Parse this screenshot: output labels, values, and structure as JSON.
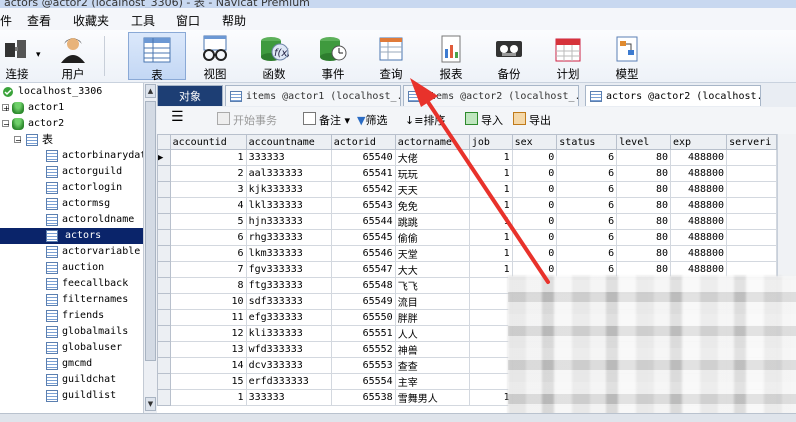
{
  "window": {
    "title": "actors @actor2 (localhost_3306) - 表 - Navicat Premium"
  },
  "menu": [
    "件",
    "查看",
    "收藏夹",
    "工具",
    "窗口",
    "帮助"
  ],
  "toolbar": {
    "items": [
      {
        "label": "连接",
        "icon": "plug-icon"
      },
      {
        "label": "用户",
        "icon": "user-icon"
      },
      {
        "label": "表",
        "icon": "table-icon"
      },
      {
        "label": "视图",
        "icon": "view-glasses-icon"
      },
      {
        "label": "函数",
        "icon": "function-icon"
      },
      {
        "label": "事件",
        "icon": "event-clock-icon"
      },
      {
        "label": "查询",
        "icon": "query-icon"
      },
      {
        "label": "报表",
        "icon": "report-icon"
      },
      {
        "label": "备份",
        "icon": "backup-icon"
      },
      {
        "label": "计划",
        "icon": "calendar-icon"
      },
      {
        "label": "模型",
        "icon": "model-icon"
      }
    ],
    "active": "表"
  },
  "tree": {
    "connection": "localhost_3306",
    "databases": [
      "actor1",
      "actor2"
    ],
    "group_label": "表",
    "tables": [
      "actorbinarydata",
      "actorguild",
      "actorlogin",
      "actormsg",
      "actoroldname",
      "actors",
      "actorvariable",
      "auction",
      "feecallback",
      "filternames",
      "friends",
      "globalmails",
      "globaluser",
      "gmcmd",
      "guildchat",
      "guildlist"
    ],
    "selected": "actors"
  },
  "tabs": {
    "object_label": "对象",
    "items": [
      "items @actor1 (localhost_...",
      "items @actor2 (localhost_...",
      "actors @actor2 (localhost..."
    ]
  },
  "subtoolbar": {
    "begin_tx": "开始事务",
    "memo": "备注",
    "filter": "筛选",
    "sort": "排序",
    "import": "导入",
    "export": "导出"
  },
  "grid": {
    "columns": [
      "accountid",
      "accountname",
      "actorid",
      "actorname",
      "job",
      "sex",
      "status",
      "level",
      "exp",
      "serveri"
    ],
    "rows": [
      [
        "1",
        "333333",
        "65540",
        "大佬",
        "1",
        "0",
        "6",
        "80",
        "488800",
        ""
      ],
      [
        "2",
        "aal333333",
        "65541",
        "玩玩",
        "1",
        "0",
        "6",
        "80",
        "488800",
        ""
      ],
      [
        "3",
        "kjk333333",
        "65542",
        "天天",
        "1",
        "0",
        "6",
        "80",
        "488800",
        ""
      ],
      [
        "4",
        "lkl333333",
        "65543",
        "免免",
        "1",
        "0",
        "6",
        "80",
        "488800",
        ""
      ],
      [
        "5",
        "hjn333333",
        "65544",
        "跳跳",
        "1",
        "0",
        "6",
        "80",
        "488800",
        ""
      ],
      [
        "6",
        "rhg333333",
        "65545",
        "偷偷",
        "1",
        "0",
        "6",
        "80",
        "488800",
        ""
      ],
      [
        "6",
        "lkm333333",
        "65546",
        "天堂",
        "1",
        "0",
        "6",
        "80",
        "488800",
        ""
      ],
      [
        "7",
        "fgv333333",
        "65547",
        "大大",
        "1",
        "0",
        "6",
        "80",
        "488800",
        ""
      ],
      [
        "8",
        "ftg333333",
        "65548",
        "飞飞",
        "",
        "",
        "",
        "",
        "",
        ""
      ],
      [
        "10",
        "sdf333333",
        "65549",
        "流目",
        "",
        "",
        "",
        "",
        "",
        ""
      ],
      [
        "11",
        "efg333333",
        "65550",
        "胖胖",
        "",
        "",
        "",
        "",
        "",
        ""
      ],
      [
        "12",
        "kli333333",
        "65551",
        "人人",
        "",
        "",
        "",
        "",
        "",
        ""
      ],
      [
        "13",
        "wfd333333",
        "65552",
        "神兽",
        "",
        "",
        "",
        "",
        "",
        ""
      ],
      [
        "14",
        "dcv333333",
        "65553",
        "查查",
        "",
        "",
        "",
        "",
        "",
        ""
      ],
      [
        "15",
        "erfd333333",
        "65554",
        "主宰",
        "",
        "",
        "",
        "",
        "",
        ""
      ],
      [
        "1",
        "333333",
        "65538",
        "雪舞男人",
        "1",
        "",
        "",
        "",
        "",
        ""
      ]
    ]
  },
  "colors": {
    "arrow": "#e8322b",
    "selection": "#0a246a",
    "object_tab": "#1d3e74"
  }
}
